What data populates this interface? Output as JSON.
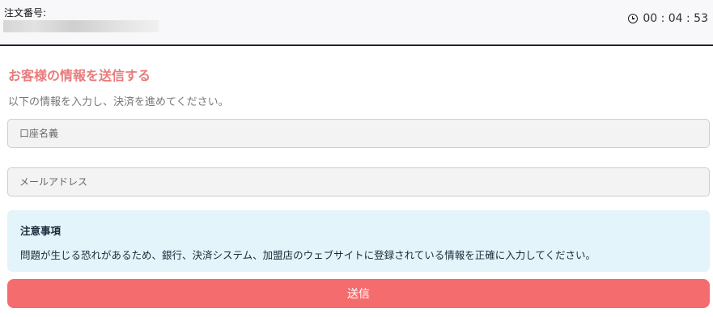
{
  "header": {
    "order_label": "注文番号:",
    "timer": "00 : 04 : 53",
    "timer_icon": "clock-icon"
  },
  "form": {
    "title": "お客様の情報を送信する",
    "subtitle": "以下の情報を入力し、決済を進めてください。",
    "account_name_placeholder": "口座名義",
    "email_placeholder": "メールアドレス"
  },
  "notice": {
    "title": "注意事項",
    "text": "問題が生じる恐れがあるため、銀行、決済システム、加盟店のウェブサイトに登録されている情報を正確に入力してください。"
  },
  "submit_label": "送信",
  "colors": {
    "accent": "#f56c6f",
    "title": "#e87c7c",
    "notice_bg": "#e3f4fb"
  }
}
